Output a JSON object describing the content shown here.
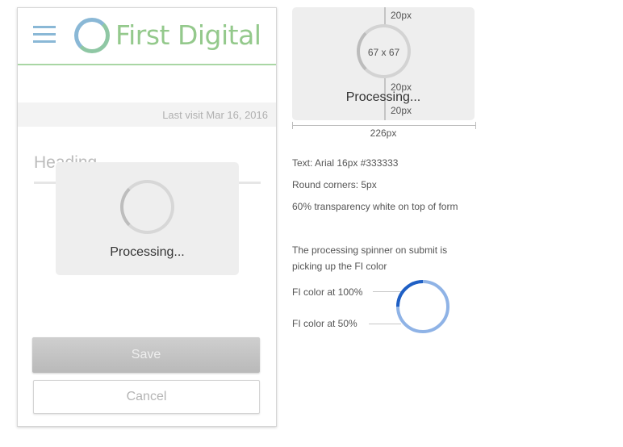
{
  "app": {
    "brand_name": "First Digital",
    "last_visit": "Last visit Mar 16, 2016",
    "heading": "Heading",
    "processing_text": "Processing...",
    "save_label": "Save",
    "cancel_label": "Cancel"
  },
  "spec": {
    "top_gap": "20px",
    "spinner_size": "67 x 67",
    "gap_below_spinner": "20px",
    "processing_text": "Processing...",
    "bottom_gap": "20px",
    "width_label": "226px",
    "notes": [
      "Text: Arial 16px #333333",
      "Round corners: 5px",
      "60% transparency white on top of form"
    ],
    "spinner_note_line1": "The processing spinner on submit is",
    "spinner_note_line2": "picking up the FI color",
    "fi_color_100": "FI color at 100%",
    "fi_color_50": "FI color at 50%"
  },
  "colors": {
    "brand_green": "#94c98c",
    "brand_blue": "#8ab8d6",
    "fi_color_100": "#1f5fc4",
    "fi_color_50": "#8fb3e6",
    "overlay_bg": "#eeeeee",
    "text": "#333333"
  },
  "icons": {
    "menu": "hamburger-icon",
    "logo": "ring-logo-icon",
    "spinner": "spinner-icon"
  }
}
